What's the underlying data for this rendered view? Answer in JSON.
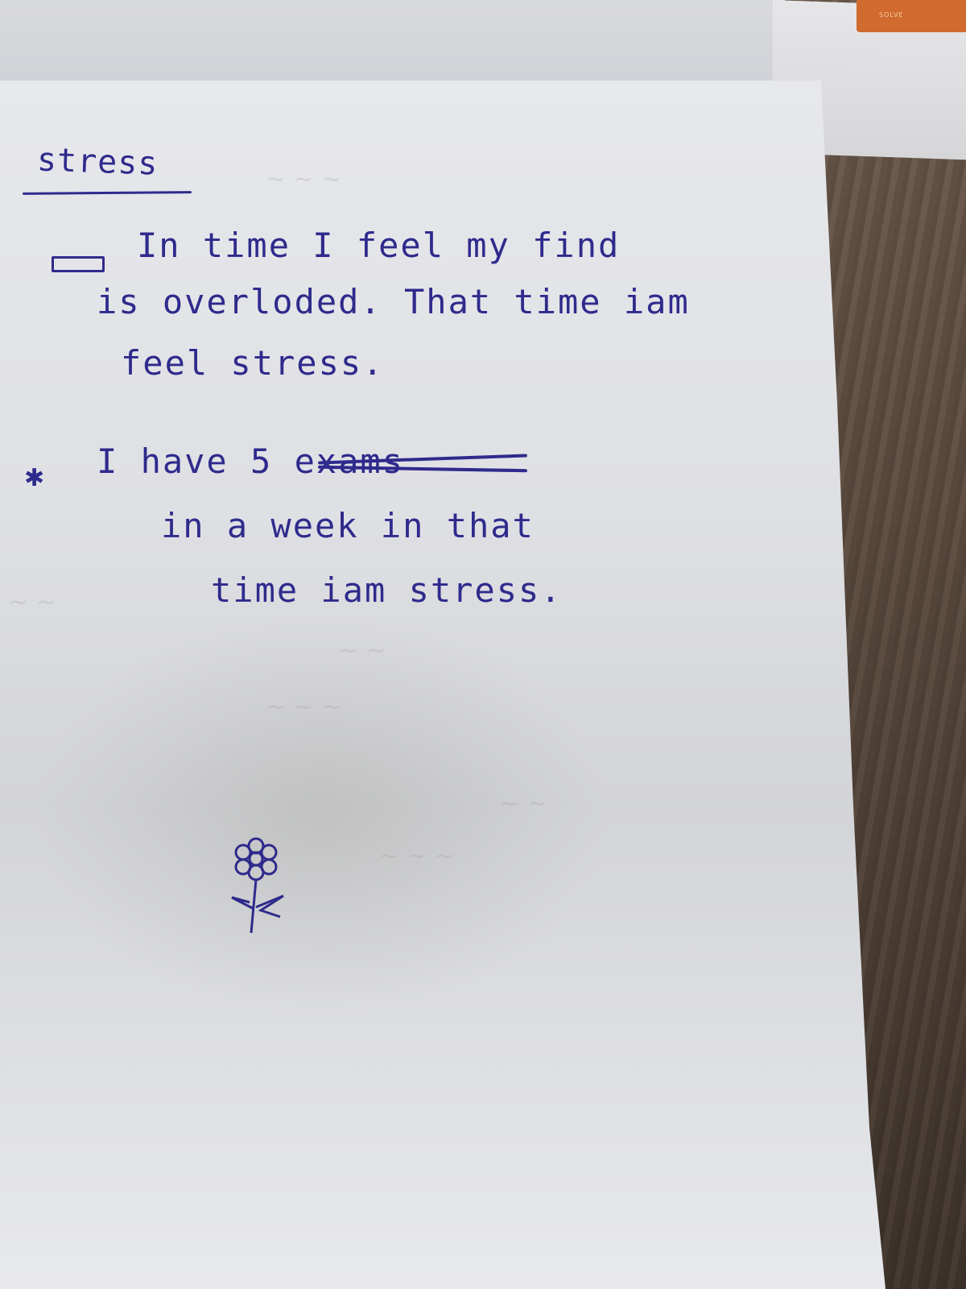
{
  "photo": {
    "orange_tab_text": "SOLVE"
  },
  "note": {
    "title": "stress",
    "lines": [
      "In time I feel my find",
      "is overloded. That time iam",
      "feel stress.",
      "I have 5 exams",
      "in a week in that",
      "time iam stress."
    ]
  }
}
